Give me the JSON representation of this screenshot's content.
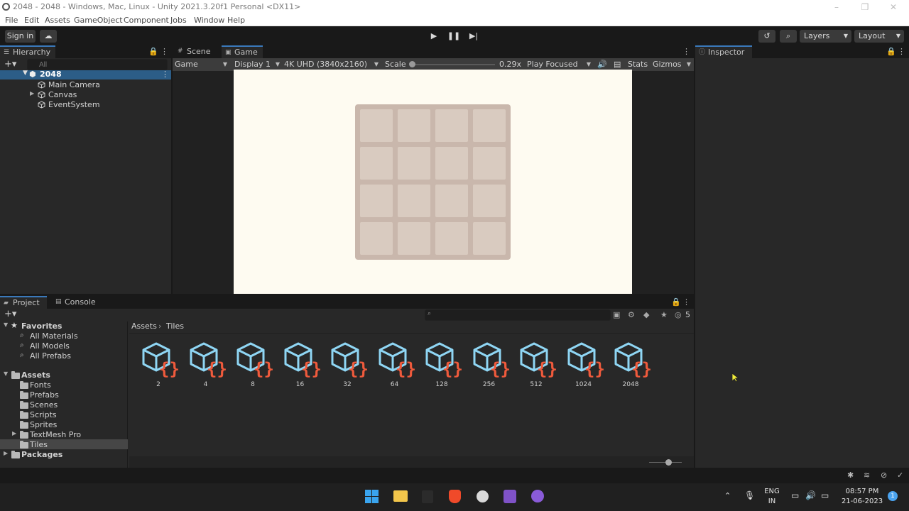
{
  "window": {
    "title": "2048 - 2048 - Windows, Mac, Linux - Unity 2021.3.20f1 Personal <DX11>"
  },
  "menu": [
    "File",
    "Edit",
    "Assets",
    "GameObject",
    "Component",
    "Jobs",
    "Window",
    "Help"
  ],
  "toolbar": {
    "sign_in": "Sign in",
    "layers": "Layers",
    "layout": "Layout"
  },
  "hierarchy": {
    "tab_label": "Hierarchy",
    "search_placeholder": "All",
    "scene_name": "2048",
    "items": [
      "Main Camera",
      "Canvas",
      "EventSystem"
    ]
  },
  "game_view": {
    "tabs": [
      "Scene",
      "Game"
    ],
    "active_tab": "Game",
    "mode": "Game",
    "display": "Display 1",
    "resolution": "4K UHD (3840x2160)",
    "scale_label": "Scale",
    "scale_value": "0.29x",
    "play_mode": "Play Focused",
    "stats": "Stats",
    "gizmos": "Gizmos",
    "board": {
      "rows": 4,
      "cols": 4
    },
    "colors": {
      "canvas": "#fefbf1",
      "board": "#c9b7ac",
      "cell": "#d9cbc0"
    }
  },
  "inspector": {
    "tab_label": "Inspector"
  },
  "project": {
    "tabs": [
      "Project",
      "Console"
    ],
    "hidden_count": "5",
    "favorites_label": "Favorites",
    "favorites": [
      "All Materials",
      "All Models",
      "All Prefabs"
    ],
    "assets_label": "Assets",
    "folders": [
      "Fonts",
      "Prefabs",
      "Scenes",
      "Scripts",
      "Sprites",
      "TextMesh Pro",
      "Tiles"
    ],
    "packages_label": "Packages",
    "breadcrumb": [
      "Assets",
      "Tiles"
    ],
    "items": [
      "2",
      "4",
      "8",
      "16",
      "32",
      "64",
      "128",
      "256",
      "512",
      "1024",
      "2048"
    ]
  },
  "taskbar": {
    "lang_top": "ENG",
    "lang_bottom": "IN",
    "time": "08:57 PM",
    "date": "21-06-2023",
    "notifications": "1"
  }
}
